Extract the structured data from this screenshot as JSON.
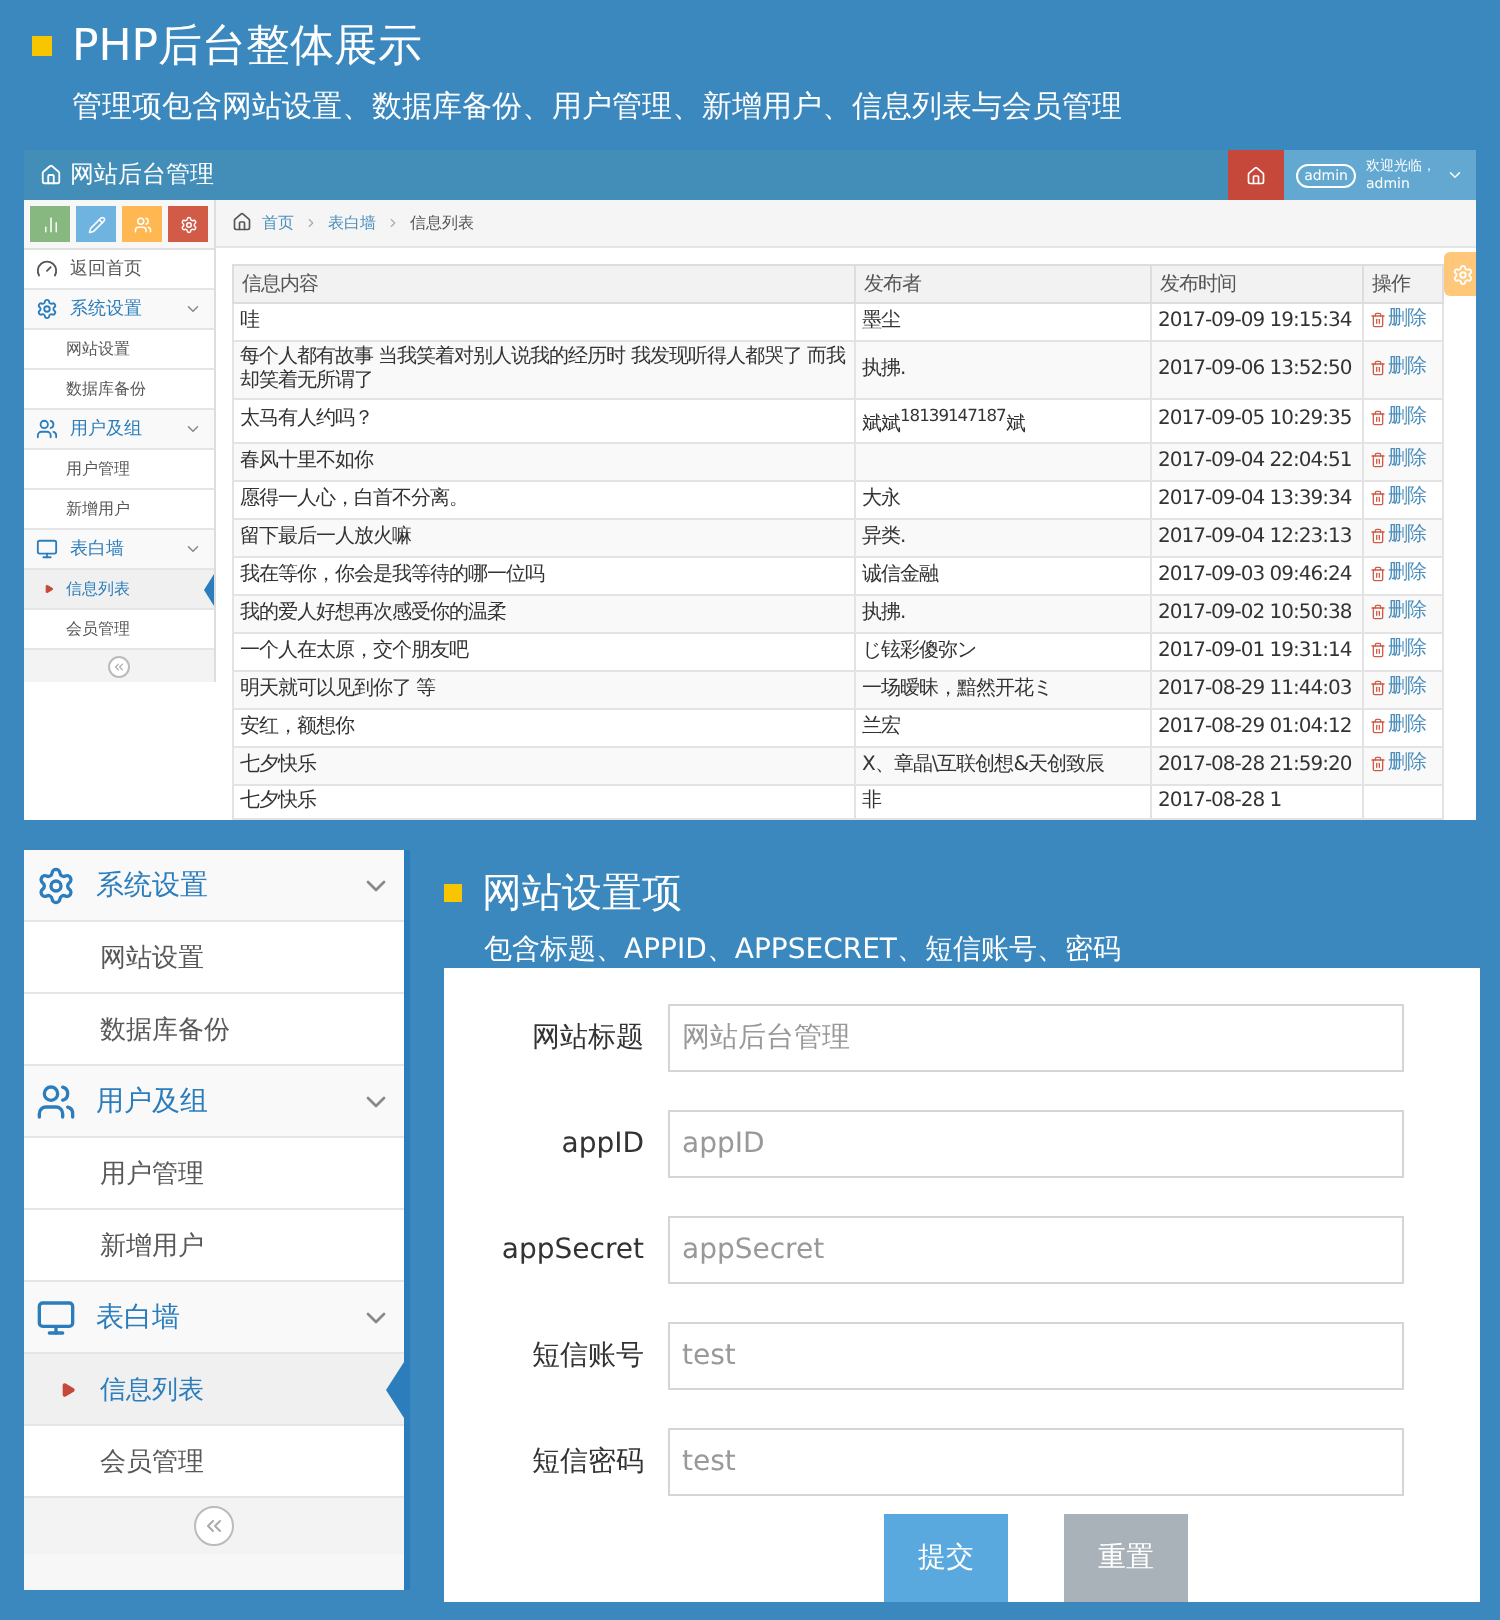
{
  "header": {
    "title": "PHP后台整体展示",
    "subtitle": "管理项包含网站设置、数据库备份、用户管理、新增用户、信息列表与会员管理"
  },
  "admin": {
    "brand": "网站后台管理",
    "avatar_text": "admin",
    "greeting": "欢迎光临，",
    "user_name": "admin",
    "sidebar": {
      "items": [
        {
          "kind": "link",
          "label": "返回首页"
        },
        {
          "kind": "group",
          "label": "系统设置",
          "expanded": true,
          "children": [
            {
              "label": "网站设置",
              "selected": false
            },
            {
              "label": "数据库备份",
              "selected": false
            }
          ]
        },
        {
          "kind": "group",
          "label": "用户及组",
          "expanded": true,
          "children": [
            {
              "label": "用户管理",
              "selected": false
            },
            {
              "label": "新增用户",
              "selected": false
            }
          ]
        },
        {
          "kind": "group",
          "label": "表白墙",
          "expanded": true,
          "children": [
            {
              "label": "信息列表",
              "selected": true
            },
            {
              "label": "会员管理",
              "selected": false
            }
          ]
        }
      ]
    },
    "breadcrumb": [
      "首页",
      "表白墙",
      "信息列表"
    ],
    "table": {
      "columns": [
        "信息内容",
        "发布者",
        "发布时间",
        "操作"
      ],
      "rows": [
        {
          "content": "哇",
          "author": "墨尘",
          "time": "2017-09-09 19:15:34",
          "action": "删除"
        },
        {
          "content": "每个人都有故事 当我笑着对别人说我的经历时 我发现听得人都哭了 而我却笑着无所谓了",
          "author": "执拂.",
          "time": "2017-09-06 13:52:50",
          "action": "删除"
        },
        {
          "content": "太马有人约吗？",
          "author": "斌斌$^{18139147187}$斌",
          "time": "2017-09-05 10:29:35",
          "action": "删除"
        },
        {
          "content": "春风十里不如你",
          "time": "2017-09-04 22:04:51",
          "action": "删除"
        },
        {
          "content": "愿得一人心，白首不分离。",
          "author": "大永",
          "time": "2017-09-04 13:39:34",
          "action": "删除"
        },
        {
          "content": "留下最后一人放火嘛",
          "author": "异类.",
          "time": "2017-09-04 12:23:13",
          "action": "删除"
        },
        {
          "content": "我在等你，你会是我等待的哪一位吗",
          "author": "诚信金融",
          "time": "2017-09-03 09:46:24",
          "action": "删除"
        },
        {
          "content": "我的爱人好想再次感受你的温柔",
          "author": "执拂.",
          "time": "2017-09-02 10:50:38",
          "action": "删除"
        },
        {
          "content": "一个人在太原，交个朋友吧",
          "author": "じ铉彩傻弥ン",
          "time": "2017-09-01 19:31:14",
          "action": "删除"
        },
        {
          "content": "明天就可以见到你了 等",
          "author": "一场暧昧，黯然开花ミ",
          "time": "2017-08-29 11:44:03",
          "action": "删除"
        },
        {
          "content": "安红，额想你",
          "author": "兰宏",
          "time": "2017-08-29 01:04:12",
          "action": "删除"
        },
        {
          "content": "七夕快乐",
          "author": "X、章晶\\互联创想&天创致辰",
          "time": "2017-08-28 21:59:20",
          "action": "删除"
        },
        {
          "content": "七夕快乐",
          "author": "非",
          "time": "2017-08-28 1"
        }
      ]
    }
  },
  "settings_sidebar": {
    "items": [
      {
        "kind": "group",
        "label": "系统设置",
        "expanded": true,
        "children": [
          {
            "label": "网站设置",
            "selected": false
          },
          {
            "label": "数据库备份",
            "selected": false
          }
        ]
      },
      {
        "kind": "group",
        "label": "用户及组",
        "expanded": true,
        "children": [
          {
            "label": "用户管理",
            "selected": false
          },
          {
            "label": "新增用户",
            "selected": false
          }
        ]
      },
      {
        "kind": "group",
        "label": "表白墙",
        "expanded": true,
        "children": [
          {
            "label": "信息列表",
            "selected": true
          },
          {
            "label": "会员管理",
            "selected": false
          }
        ]
      }
    ]
  },
  "settings_form": {
    "title": "网站设置项",
    "subtitle": "包含标题、APPID、APPSECRET、短信账号、密码",
    "fields": [
      {
        "label": "网站标题",
        "placeholder": "网站后台管理"
      },
      {
        "label": "appID",
        "placeholder": "appID"
      },
      {
        "label": "appSecret",
        "placeholder": "appSecret"
      },
      {
        "label": "短信账号",
        "placeholder": "test"
      },
      {
        "label": "短信密码",
        "placeholder": "test"
      }
    ],
    "buttons": [
      {
        "kind": "primary",
        "label": "提交"
      },
      {
        "kind": "secondary",
        "label": "重置"
      }
    ]
  }
}
